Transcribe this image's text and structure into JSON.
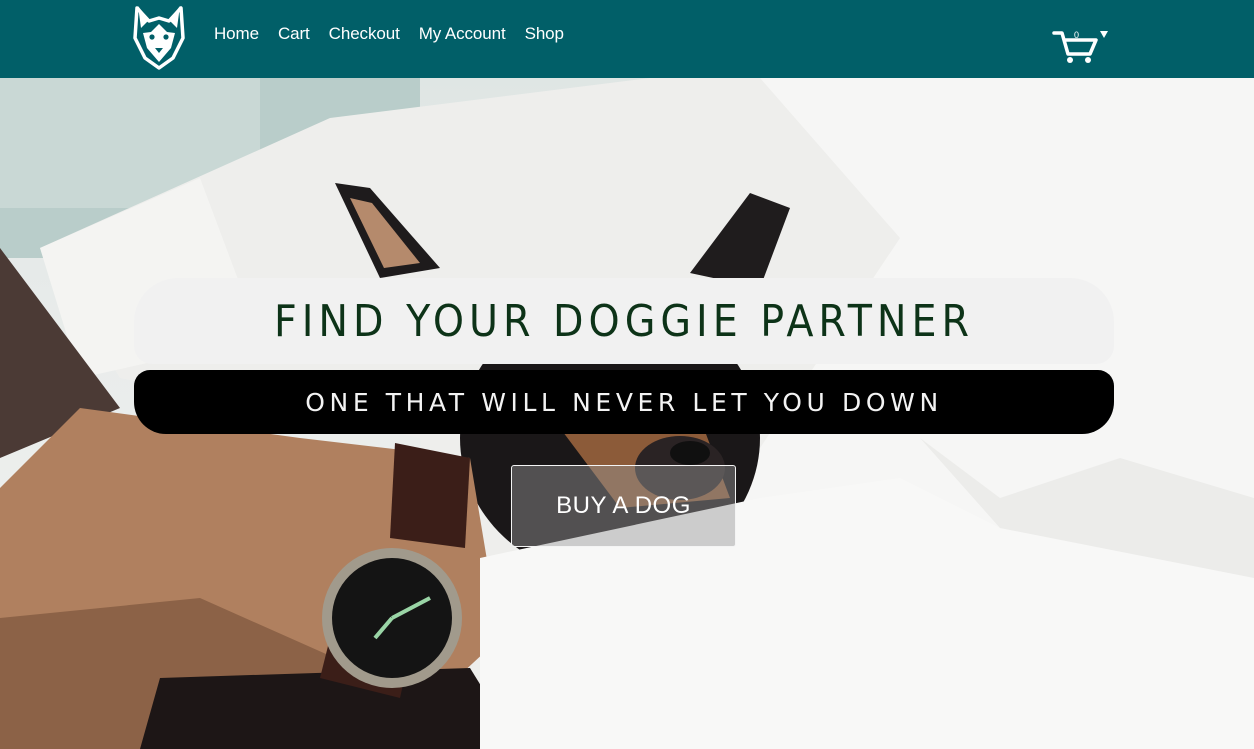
{
  "header": {
    "brand_logo_icon": "husky-logo-icon",
    "nav": [
      {
        "label": "Home"
      },
      {
        "label": "Cart"
      },
      {
        "label": "Checkout"
      },
      {
        "label": "My Account"
      },
      {
        "label": "Shop"
      }
    ],
    "cart": {
      "icon": "cart-icon",
      "count": "0"
    }
  },
  "hero": {
    "headline": "FIND YOUR DOGGIE PARTNER",
    "subheadline": "ONE THAT WILL NEVER LET YOU DOWN",
    "cta_label": "BUY A DOG"
  },
  "colors": {
    "header_bg": "#015f68",
    "headline_text": "#0d3318",
    "headline_bg": "#f1f1f1",
    "subheadline_bg": "#000000"
  }
}
